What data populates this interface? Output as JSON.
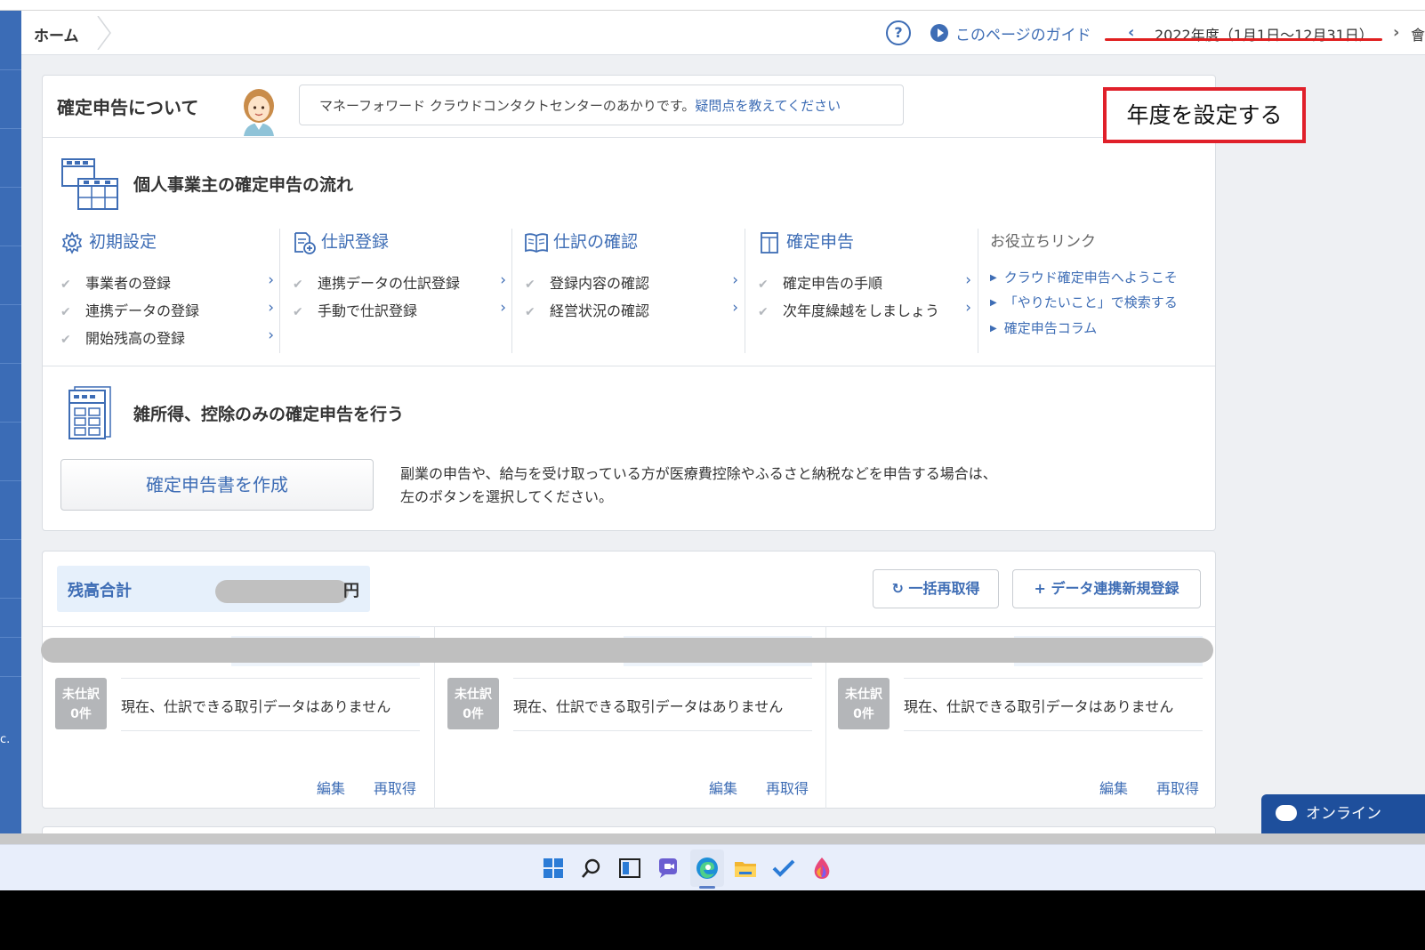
{
  "header": {
    "breadcrumb_home": "ホーム",
    "help_symbol": "?",
    "guide_label": "このページのガイド",
    "fiscal_year": "2022年度（1月1日〜12月31日）",
    "fy_prev_symbol": "‹",
    "fy_next_symbol": "›",
    "clipped_glyph": "會"
  },
  "annotation": "年度を設定する",
  "about": {
    "title": "確定申告について",
    "bubble_text": "マネーフォワード クラウドコンタクトセンターのあかりです。",
    "bubble_link": "疑問点を教えてください"
  },
  "flow": {
    "title": "個人事業主の確定申告の流れ",
    "check_symbol": "✔",
    "chevron_symbol": "›",
    "columns": [
      {
        "title": "初期設定",
        "icon": "gear-icon",
        "items": [
          "事業者の登録",
          "連携データの登録",
          "開始残高の登録"
        ]
      },
      {
        "title": "仕訳登録",
        "icon": "journal-add-icon",
        "items": [
          "連携データの仕訳登録",
          "手動で仕訳登録"
        ]
      },
      {
        "title": "仕訳の確認",
        "icon": "book-icon",
        "items": [
          "登録内容の確認",
          "経営状況の確認"
        ]
      },
      {
        "title": "確定申告",
        "icon": "document-icon",
        "items": [
          "確定申告の手順",
          "次年度繰越をしましょう"
        ]
      }
    ],
    "links_title": "お役立ちリンク",
    "links": [
      "クラウド確定申告へようこそ",
      "「やりたいこと」で検索する",
      "確定申告コラム"
    ]
  },
  "misc": {
    "title": "雑所得、控除のみの確定申告を行う",
    "button_label": "確定申告書を作成",
    "description_line1": "副業の申告や、給与を受け取っている方が医療費控除やふるさと納税などを申告する場合は、",
    "description_line2": "左のボタンを選択してください。"
  },
  "balance": {
    "label": "残高合計",
    "unit": "円",
    "refetch_all_label": "一括再取得",
    "refetch_icon": "↻",
    "add_link_label": "データ連携新規登録",
    "add_icon": "+"
  },
  "accounts": [
    {
      "badge_line1": "未仕訳",
      "badge_line2": "0件",
      "message": "現在、仕訳できる取引データはありません",
      "edit_label": "編集",
      "refetch_label": "再取得"
    },
    {
      "badge_line1": "未仕訳",
      "badge_line2": "0件",
      "message": "現在、仕訳できる取引データはありません",
      "edit_label": "編集",
      "refetch_label": "再取得"
    },
    {
      "badge_line1": "未仕訳",
      "badge_line2": "0件",
      "message": "現在、仕訳できる取引データはありません",
      "edit_label": "編集",
      "refetch_label": "再取得"
    }
  ],
  "chat": {
    "label": "オンライン"
  },
  "sidebar_edge_text": "c.",
  "colors": {
    "accent": "#3e6db5",
    "annotation_red": "#e0202a",
    "sidebar": "#3b6cb6",
    "chat": "#1e4f9c"
  }
}
